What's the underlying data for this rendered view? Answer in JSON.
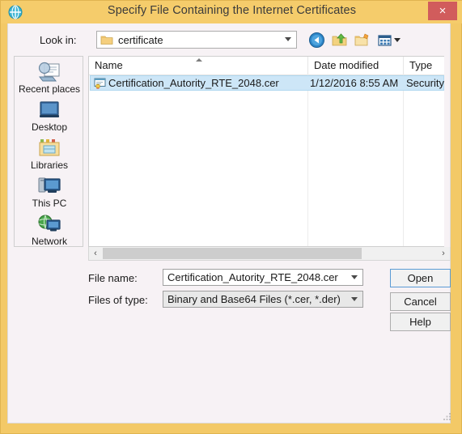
{
  "window": {
    "title": "Specify File Containing the Internet Certificates",
    "icon": "globe-certificate-icon",
    "close_label": "×",
    "frame_color": "#f3c967",
    "titlebar_color": "#f5cc6b",
    "close_button_color": "#d15c5c"
  },
  "lookin": {
    "label": "Look in:",
    "value": "certificate",
    "folder_icon": "folder-icon",
    "dropdown_icon": "chevron-down-icon"
  },
  "toolbar": {
    "back": "back-navigation-icon",
    "up": "up-one-level-icon",
    "new_folder": "new-folder-icon",
    "views": "views-icon",
    "views_dropdown": "chevron-down-icon"
  },
  "places": [
    {
      "label": "Recent places",
      "icon": "recent-places-icon"
    },
    {
      "label": "Desktop",
      "icon": "desktop-icon"
    },
    {
      "label": "Libraries",
      "icon": "libraries-icon"
    },
    {
      "label": "This PC",
      "icon": "this-pc-icon"
    },
    {
      "label": "Network",
      "icon": "network-icon"
    }
  ],
  "file_list": {
    "columns": [
      "Name",
      "Date modified",
      "Type"
    ],
    "sort_column": "Name",
    "sort_direction": "ascending",
    "selection_color": "#cde6f7",
    "rows": [
      {
        "name": "Certification_Autority_RTE_2048.cer",
        "date_modified": "1/12/2016 8:55 AM",
        "type": "Security C",
        "icon": "certificate-file-icon",
        "selected": true
      }
    ]
  },
  "scrollbar": {
    "left_arrow": "‹",
    "right_arrow": "›"
  },
  "form": {
    "filename_label": "File name:",
    "filename_value": "Certification_Autority_RTE_2048.cer",
    "filetype_label": "Files of type:",
    "filetype_value": "Binary and Base64 Files (*.cer, *.der)"
  },
  "buttons": {
    "open": "Open",
    "cancel": "Cancel",
    "help": "Help"
  }
}
